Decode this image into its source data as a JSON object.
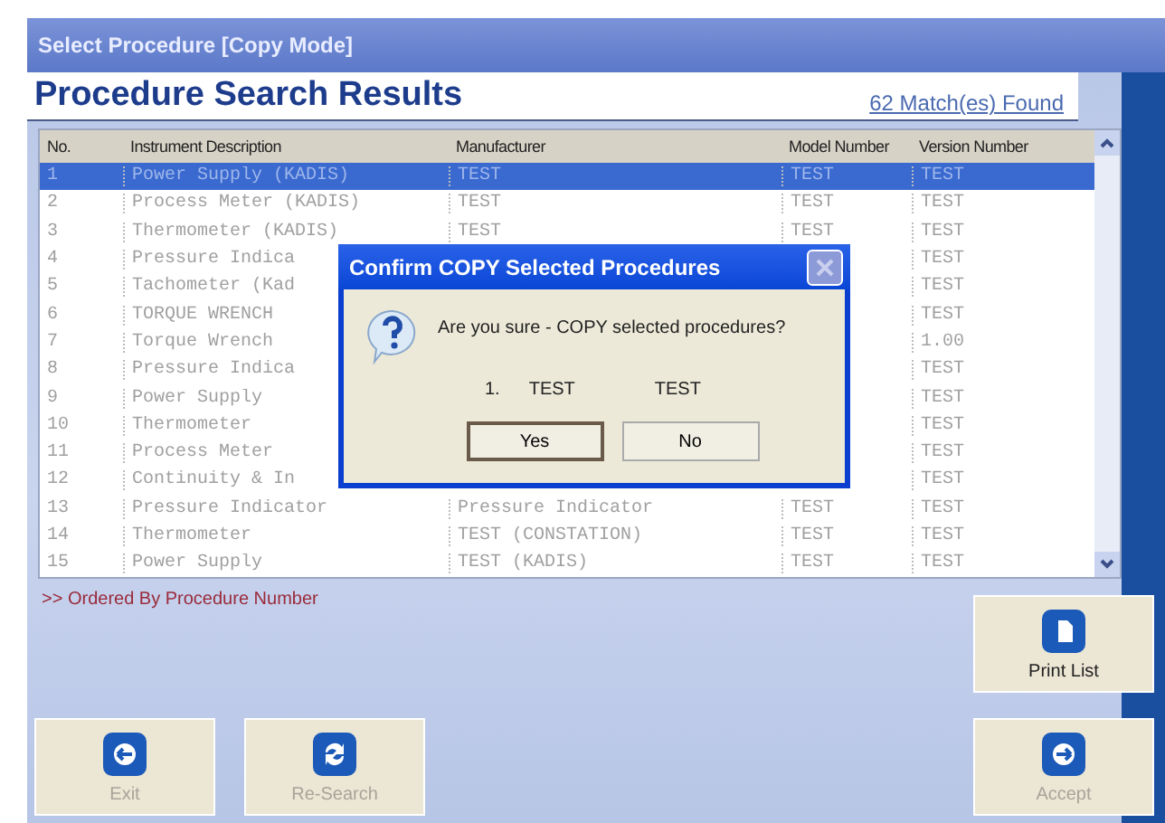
{
  "window": {
    "title": "Select Procedure [Copy Mode]"
  },
  "header": {
    "title": "Procedure Search Results",
    "match_count": "62 Match(es) Found"
  },
  "table": {
    "columns": [
      "No.",
      "Instrument Description",
      "Manufacturer",
      "Model Number",
      "Version Number"
    ],
    "rows": [
      {
        "no": "1",
        "description": "Power Supply (KADIS)",
        "manufacturer": "TEST",
        "model": "TEST",
        "version": "TEST",
        "selected": true
      },
      {
        "no": "2",
        "description": "Process Meter (KADIS)",
        "manufacturer": "TEST",
        "model": "TEST",
        "version": "TEST",
        "selected": false
      },
      {
        "no": "3",
        "description": "Thermometer (KADIS)",
        "manufacturer": "TEST",
        "model": "TEST",
        "version": "TEST",
        "selected": false
      },
      {
        "no": "4",
        "description": "Pressure Indica",
        "version": "TEST",
        "selected": false
      },
      {
        "no": "5",
        "description": "Tachometer (Kad",
        "version": "TEST",
        "selected": false
      },
      {
        "no": "6",
        "description": "TORQUE WRENCH",
        "version": "TEST",
        "selected": false
      },
      {
        "no": "7",
        "description": "Torque Wrench",
        "version": "1.00",
        "selected": false
      },
      {
        "no": "8",
        "description": "Pressure Indica",
        "version": "TEST",
        "selected": false
      },
      {
        "no": "9",
        "description": "Power Supply",
        "version": "TEST",
        "selected": false
      },
      {
        "no": "10",
        "description": "Thermometer",
        "version": "TEST",
        "selected": false
      },
      {
        "no": "11",
        "description": "Process Meter",
        "version": "TEST",
        "selected": false
      },
      {
        "no": "12",
        "description": "Continuity & In",
        "version": "TEST",
        "selected": false
      },
      {
        "no": "13",
        "description": "Pressure Indicator",
        "manufacturer": "Pressure Indicator",
        "model": "TEST",
        "version": "TEST",
        "selected": false
      },
      {
        "no": "14",
        "description": "Thermometer",
        "manufacturer": "TEST (CONSTATION)",
        "model": "TEST",
        "version": "TEST",
        "selected": false
      },
      {
        "no": "15",
        "description": "Power Supply",
        "manufacturer": "TEST (KADIS)",
        "model": "TEST",
        "version": "TEST",
        "selected": false
      }
    ]
  },
  "sort_note": ">> Ordered By Procedure Number",
  "print_button": {
    "label": "Print List",
    "kind": "document",
    "disabled": false
  },
  "bottom_left_buttons": [
    {
      "label": "Exit",
      "kind": "back",
      "disabled": true
    },
    {
      "label": "Re-Search",
      "kind": "refresh",
      "disabled": true
    }
  ],
  "accept_button": {
    "label": "Accept",
    "kind": "forward",
    "disabled": true
  },
  "dialog": {
    "title": "Confirm COPY Selected Procedures",
    "message": "Are you sure - COPY selected procedures?",
    "detail": [
      "1.",
      "TEST",
      "TEST"
    ],
    "buttons": [
      {
        "label": "Yes",
        "selected": true
      },
      {
        "label": "No",
        "selected": false
      }
    ]
  }
}
